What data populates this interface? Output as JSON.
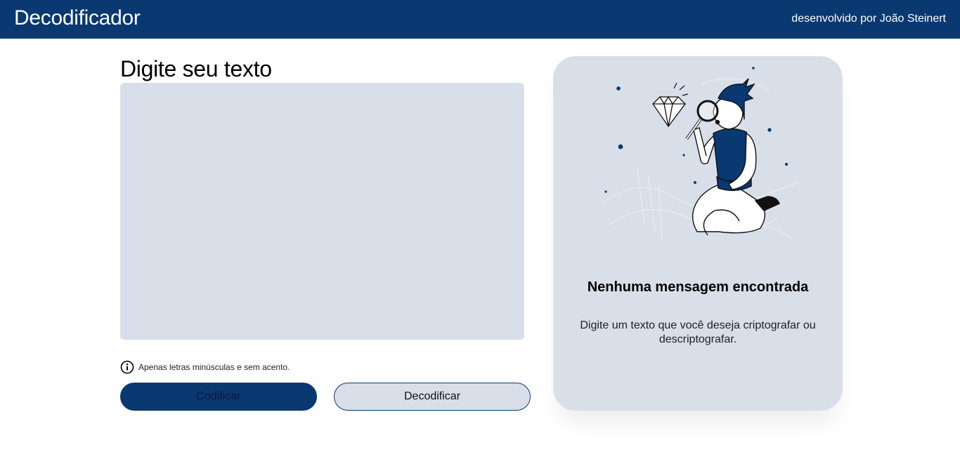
{
  "header": {
    "title": "Decodificador",
    "credits": "desenvolvido por João Steinert"
  },
  "input": {
    "heading": "Digite seu texto",
    "value": "",
    "hint": "Apenas letras minúsculas e sem acento.",
    "hint_icon": "info-icon"
  },
  "actions": {
    "encode_label": "Codificar",
    "decode_label": "Decodificar"
  },
  "output": {
    "illustration": "person-with-magnifying-glass-illustration",
    "empty_title": "Nenhuma mensagem encontrada",
    "empty_description": "Digite um texto que você deseja criptografar ou descriptografar."
  },
  "colors": {
    "primary": "#0a3871",
    "panel_bg": "#d8dfe8",
    "page_bg": "#ffffff"
  }
}
